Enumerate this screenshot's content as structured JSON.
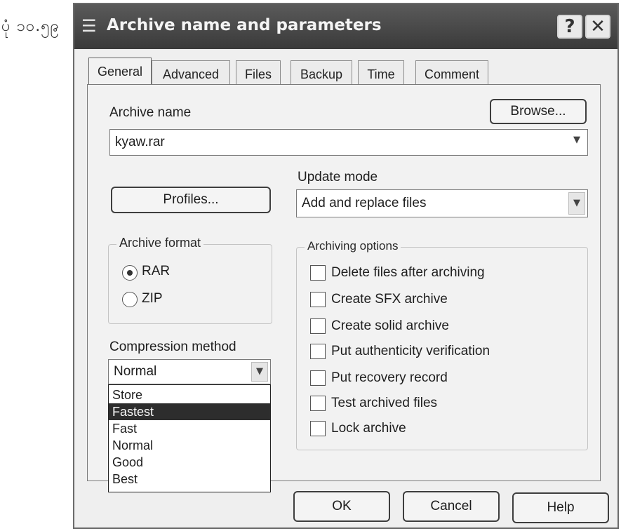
{
  "caption": "ပုံ ၁၀.၅၉",
  "window": {
    "title": "Archive name and parameters",
    "help_button": "?",
    "close_button": "✕"
  },
  "tabs": [
    "General",
    "Advanced",
    "Files",
    "Backup",
    "Time",
    "Comment"
  ],
  "general": {
    "archive_name_label": "Archive name",
    "archive_name_value": "kyaw.rar",
    "browse_label": "Browse...",
    "profiles_label": "Profiles...",
    "update_mode_label": "Update mode",
    "update_mode_value": "Add and replace files",
    "archive_format": {
      "title": "Archive format",
      "options": [
        {
          "label": "RAR",
          "selected": true
        },
        {
          "label": "ZIP",
          "selected": false
        }
      ]
    },
    "compression_method_label": "Compression method",
    "compression_method_value": "Normal",
    "compression_options": [
      "Store",
      "Fastest",
      "Fast",
      "Normal",
      "Good",
      "Best"
    ],
    "compression_highlighted": "Fastest",
    "archiving_options": {
      "title": "Archiving options",
      "items": [
        {
          "label": "Delete files after archiving",
          "checked": false
        },
        {
          "label": "Create SFX archive",
          "checked": false
        },
        {
          "label": "Create solid archive",
          "checked": false
        },
        {
          "label": "Put authenticity verification",
          "checked": false
        },
        {
          "label": "Put recovery record",
          "checked": false
        },
        {
          "label": "Test archived files",
          "checked": false
        },
        {
          "label": "Lock archive",
          "checked": false
        }
      ]
    }
  },
  "footer": {
    "ok_label": "OK",
    "cancel_label": "Cancel",
    "help_label": "Help"
  }
}
